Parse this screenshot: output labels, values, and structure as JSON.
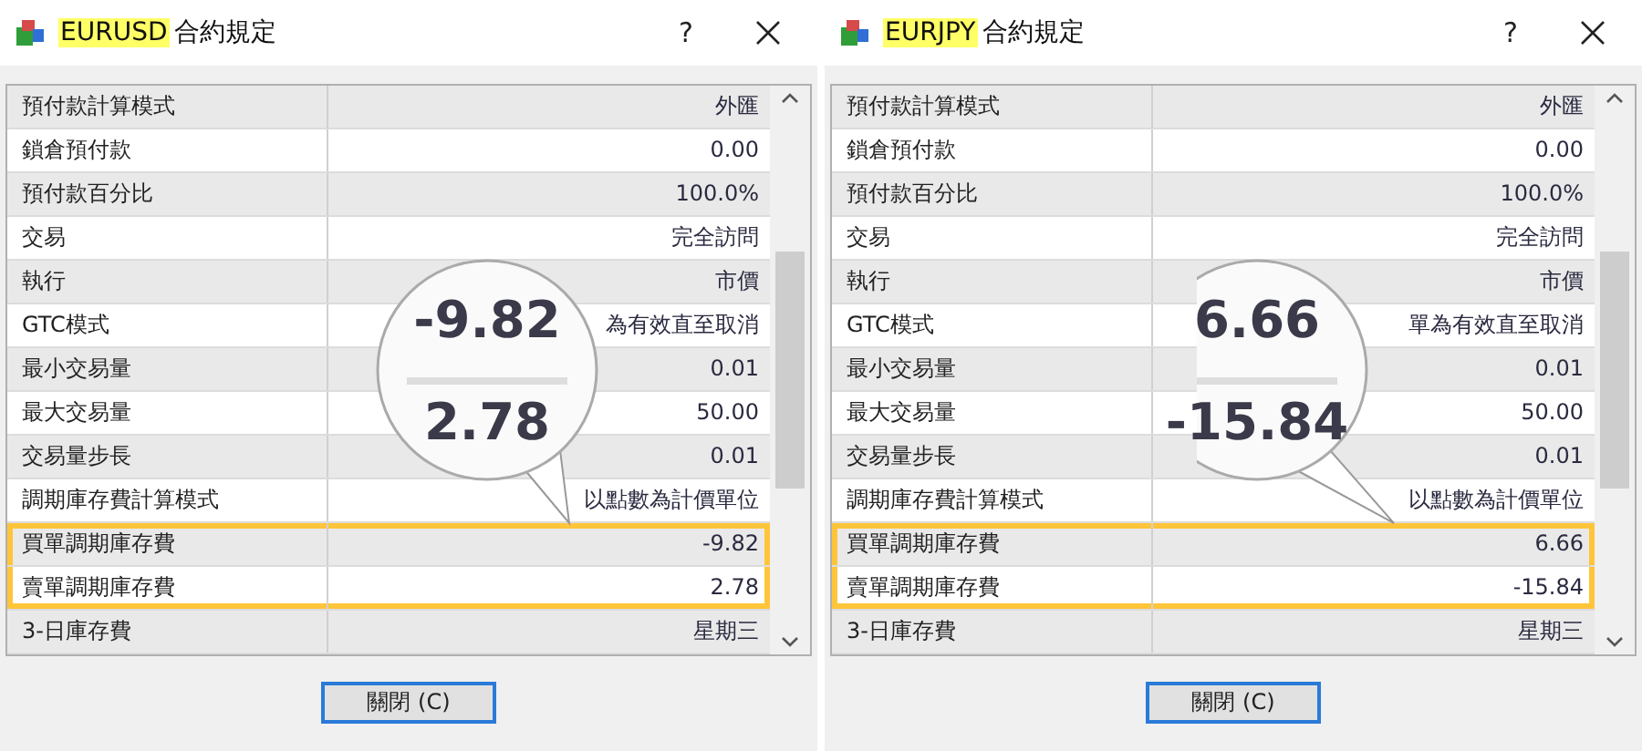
{
  "dialogs": [
    {
      "symbol": "EURUSD",
      "title": "合約規定",
      "help": "?",
      "rows": [
        {
          "label": "預付款計算模式",
          "value": "外匯",
          "highlighted": false
        },
        {
          "label": "鎖倉預付款",
          "value": "0.00",
          "highlighted": false
        },
        {
          "label": "預付款百分比",
          "value": "100.0%",
          "highlighted": false
        },
        {
          "label": "交易",
          "value": "完全訪問",
          "highlighted": false
        },
        {
          "label": "執行",
          "value": "市價",
          "highlighted": false
        },
        {
          "label": "GTC模式",
          "value": "為有效直至取消",
          "highlighted": false
        },
        {
          "label": "最小交易量",
          "value": "0.01",
          "highlighted": false
        },
        {
          "label": "最大交易量",
          "value": "50.00",
          "highlighted": false
        },
        {
          "label": "交易量步長",
          "value": "0.01",
          "highlighted": false
        },
        {
          "label": "調期庫存費計算模式",
          "value": "以點數為計價單位",
          "highlighted": false
        },
        {
          "label": "買單調期庫存費",
          "value": "-9.82",
          "highlighted": true
        },
        {
          "label": "賣單調期庫存費",
          "value": "2.78",
          "highlighted": true
        },
        {
          "label": "3-日庫存費",
          "value": "星期三",
          "highlighted": false
        }
      ],
      "magnifier": {
        "values": [
          "-9.82",
          "2.78"
        ]
      },
      "button": "關閉 (C)"
    },
    {
      "symbol": "EURJPY",
      "title": "合約規定",
      "help": "?",
      "rows": [
        {
          "label": "預付款計算模式",
          "value": "外匯",
          "highlighted": false
        },
        {
          "label": "鎖倉預付款",
          "value": "0.00",
          "highlighted": false
        },
        {
          "label": "預付款百分比",
          "value": "100.0%",
          "highlighted": false
        },
        {
          "label": "交易",
          "value": "完全訪問",
          "highlighted": false
        },
        {
          "label": "執行",
          "value": "市價",
          "highlighted": false
        },
        {
          "label": "GTC模式",
          "value": "單為有效直至取消",
          "highlighted": false
        },
        {
          "label": "最小交易量",
          "value": "0.01",
          "highlighted": false
        },
        {
          "label": "最大交易量",
          "value": "50.00",
          "highlighted": false
        },
        {
          "label": "交易量步長",
          "value": "0.01",
          "highlighted": false
        },
        {
          "label": "調期庫存費計算模式",
          "value": "以點數為計價單位",
          "highlighted": false
        },
        {
          "label": "買單調期庫存費",
          "value": "6.66",
          "highlighted": true
        },
        {
          "label": "賣單調期庫存費",
          "value": "-15.84",
          "highlighted": true
        },
        {
          "label": "3-日庫存費",
          "value": "星期三",
          "highlighted": false
        }
      ],
      "magnifier": {
        "values": [
          "6.66",
          "-15.84"
        ]
      },
      "button": "關閉 (C)"
    }
  ]
}
